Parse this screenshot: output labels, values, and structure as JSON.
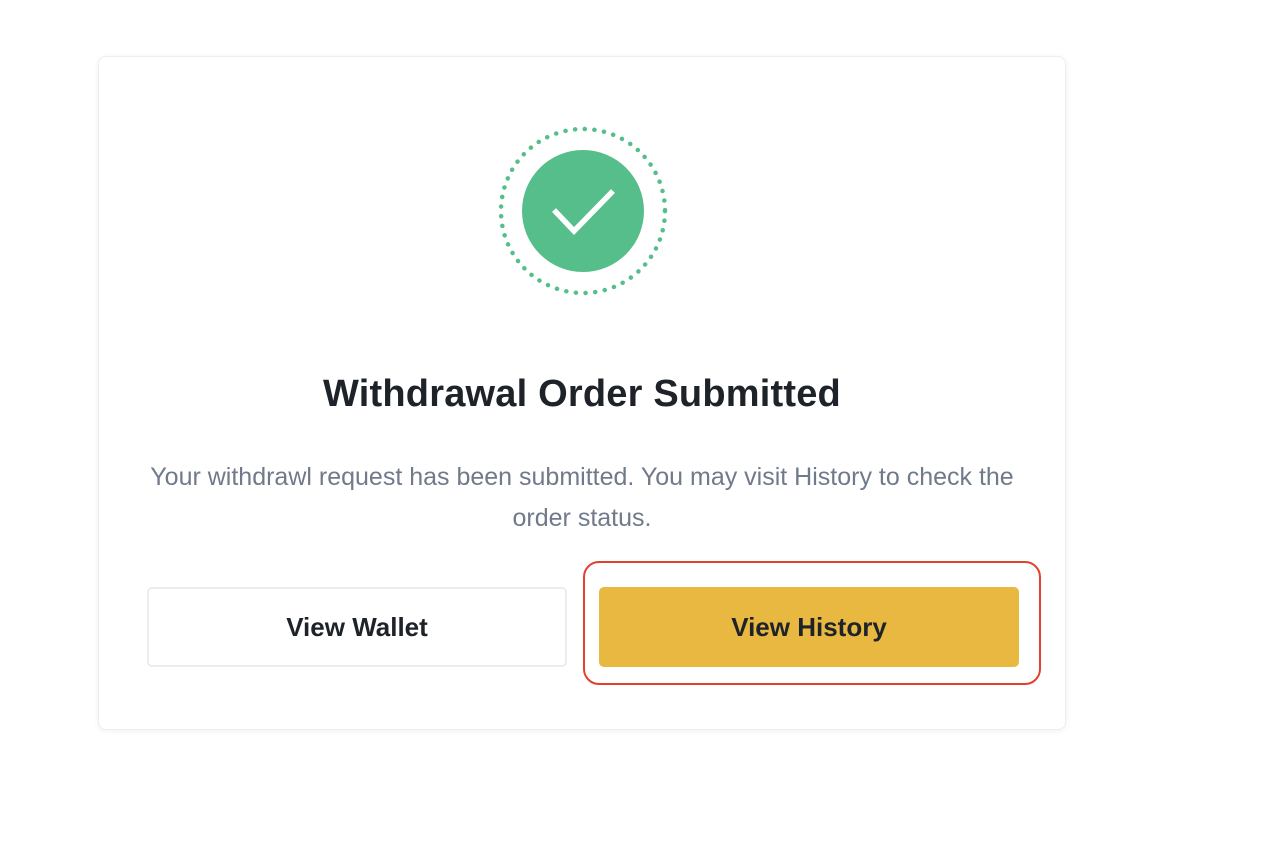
{
  "dialog": {
    "icon": "check-circle-icon",
    "title": "Withdrawal Order Submitted",
    "message": "Your withdrawl request has been submitted. You may visit History to check the order status.",
    "buttons": {
      "wallet_label": "View Wallet",
      "history_label": "View History"
    }
  },
  "colors": {
    "success_green": "#56be8a",
    "primary_yellow": "#e8b840",
    "title_text": "#1e2329",
    "body_text": "#707a8a",
    "highlight_red": "#e2412d"
  }
}
